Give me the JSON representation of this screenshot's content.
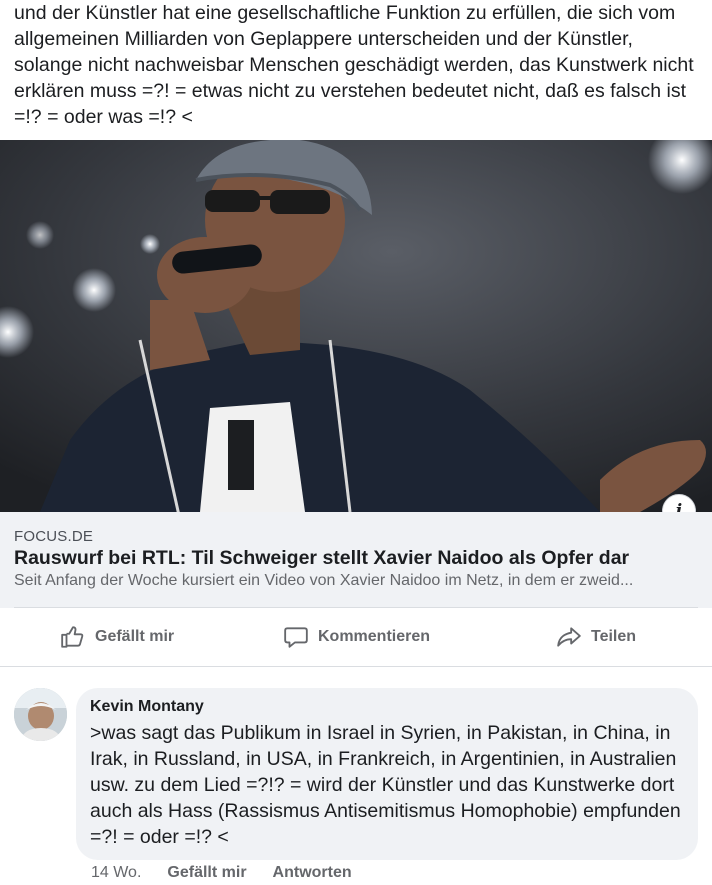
{
  "post": {
    "text": "und der Künstler hat eine gesellschaftliche Funktion zu erfüllen, die sich vom allgemeinen Milliarden von Geplappere unterscheiden und der Künstler, solange nicht nachweisbar Menschen geschädigt werden, das Kunstwerk nicht erklären muss =?! = etwas nicht zu verstehen bedeutet nicht, daß es falsch ist =!? = oder was =!? <"
  },
  "link_preview": {
    "image_icon": "info-icon",
    "info_label": "i",
    "source": "FOCUS.DE",
    "title": "Rauswurf bei RTL: Til Schweiger stellt Xavier Naidoo als Opfer dar",
    "description": "Seit Anfang der Woche kursiert ein Video von Xavier Naidoo im Netz, in dem er zweid..."
  },
  "actions": {
    "like": {
      "label": "Gefällt mir",
      "icon": "thumbs-up-icon"
    },
    "comment": {
      "label": "Kommentieren",
      "icon": "comment-bubble-icon"
    },
    "share": {
      "label": "Teilen",
      "icon": "share-arrow-icon"
    }
  },
  "comment": {
    "author": "Kevin Montany",
    "text": ">was sagt das Publikum in Israel in Syrien, in Pakistan, in China, in Irak, in Russland, in USA, in Frankreich, in Argentinien, in Australien usw. zu dem Lied =?!? = wird der Künstler und das Kunstwerke dort auch als Hass (Rassismus Antisemitismus Homophobie) empfunden =?! = oder =!? <",
    "time": "14 Wo.",
    "like_label": "Gefällt mir",
    "reply_label": "Antworten"
  },
  "colors": {
    "text_primary": "#1c1e21",
    "text_secondary": "#65676b",
    "surface": "#f0f2f5",
    "divider": "#dadde1"
  }
}
